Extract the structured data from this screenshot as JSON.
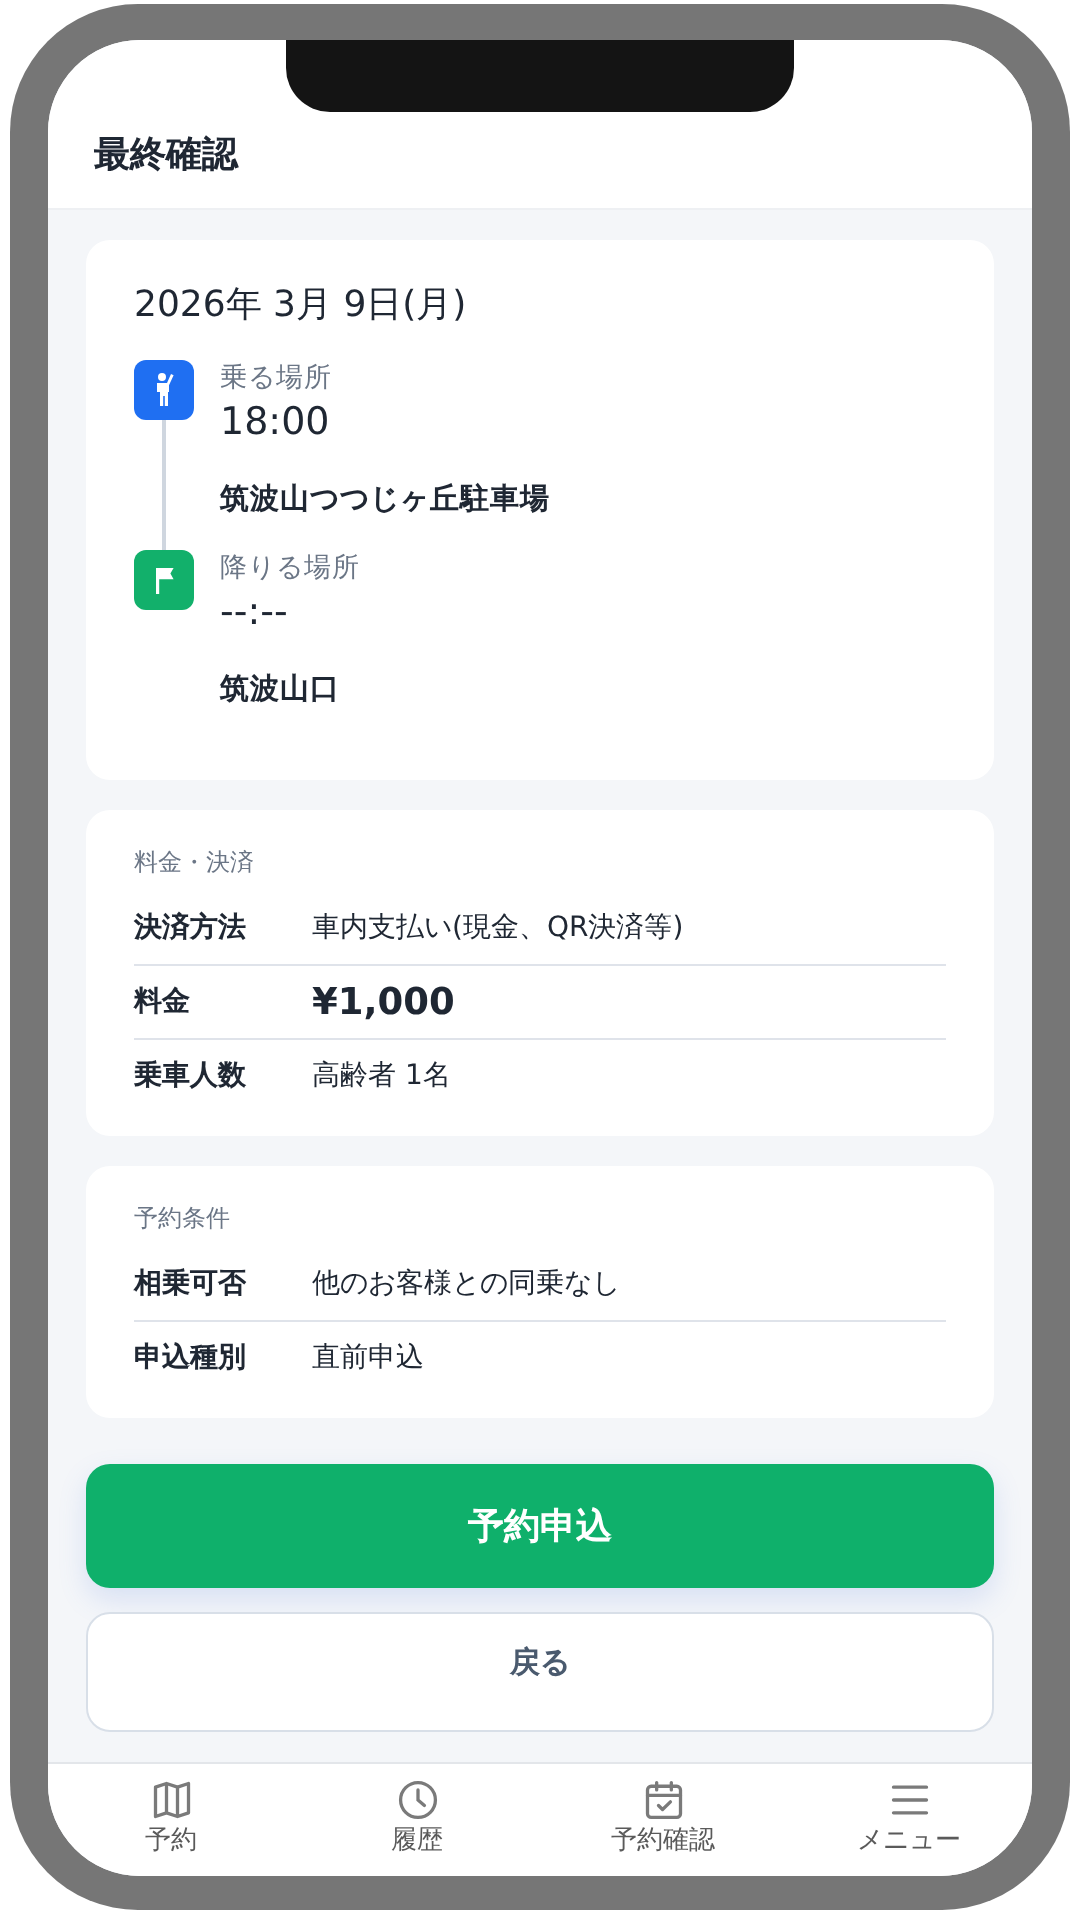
{
  "title": "最終確認",
  "trip": {
    "date": "2026年 3月 9日(月)",
    "stops": [
      {
        "kind": "pickup",
        "label": "乗る場所",
        "time": "18:00",
        "place": "筑波山つつじヶ丘駐車場"
      },
      {
        "kind": "dropoff",
        "label": "降りる場所",
        "time": "--:--",
        "place": "筑波山口"
      }
    ]
  },
  "sections": [
    {
      "heading": "料金・決済",
      "rows": [
        {
          "kind": "text",
          "label": "決済方法",
          "value": "車内支払い(現金、QR決済等)"
        },
        {
          "kind": "price",
          "label": "料金",
          "value": "¥1,000"
        },
        {
          "kind": "text",
          "label": "乗車人数",
          "value": "高齢者 1名"
        }
      ]
    },
    {
      "heading": "予約条件",
      "rows": [
        {
          "kind": "text",
          "label": "相乗可否",
          "value": "他のお客様との同乗なし"
        },
        {
          "kind": "text",
          "label": "申込種別",
          "value": "直前申込"
        }
      ]
    }
  ],
  "primary_button": "予約申込",
  "back_button": "戻る",
  "nav": [
    {
      "kind": "map",
      "label": "予約"
    },
    {
      "kind": "clock",
      "label": "履歴"
    },
    {
      "kind": "calendar",
      "label": "予約確認"
    },
    {
      "kind": "menu",
      "label": "メニュー"
    }
  ]
}
